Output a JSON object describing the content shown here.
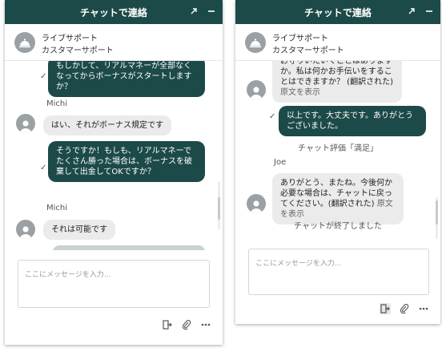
{
  "chat_left": {
    "header_title": "チャットで連絡",
    "agent_name": "ライブサポート",
    "agent_team": "カスタマーサポート",
    "messages": {
      "m1": "もしかして、リアルマネーが全部なくなってからボーナスがスタートしますか？",
      "sender1": "Michi",
      "m2": "はい、それがボーナス規定です",
      "m3": "そうですか！もしも、リアルマネーでたくさん勝った場合は、ボーナスを破棄して出金してOKですか？",
      "sender2": "Michi",
      "m4": "それは可能です"
    },
    "composer_placeholder": "ここにメッセージを入力..."
  },
  "chat_right": {
    "header_title": "チャットで連絡",
    "agent_name": "ライブサポート",
    "agent_team": "カスタマーサポート",
    "messages": {
      "m1": "お守りいたいくことはありますか。私は何かお手伝いをすることはできますか？ (翻訳された)",
      "m1_orig": "原文を表示",
      "m2": "以上です。大丈夫です。ありがとうございました。",
      "sys1": "チャット評価「満足」",
      "sender1": "Joe",
      "m3": "ありがとう、またね。今後何か必要な場合は、チャットに戻ってください。(翻訳された)",
      "m3_orig": "原文を表示",
      "sys2": "チャットが終了しました"
    },
    "composer_placeholder": "ここにメッセージを入力..."
  },
  "icons": {
    "header": [
      "expand-icon",
      "minimize-icon"
    ],
    "footer": [
      "end-chat-icon",
      "attach-icon",
      "more-icon"
    ],
    "agent": "concierge-bell-icon",
    "user": "user-avatar-icon",
    "delivered": "checkmark-icon"
  },
  "colors": {
    "brand": "#1c4a48",
    "incoming_bubble": "#ebebeb"
  }
}
